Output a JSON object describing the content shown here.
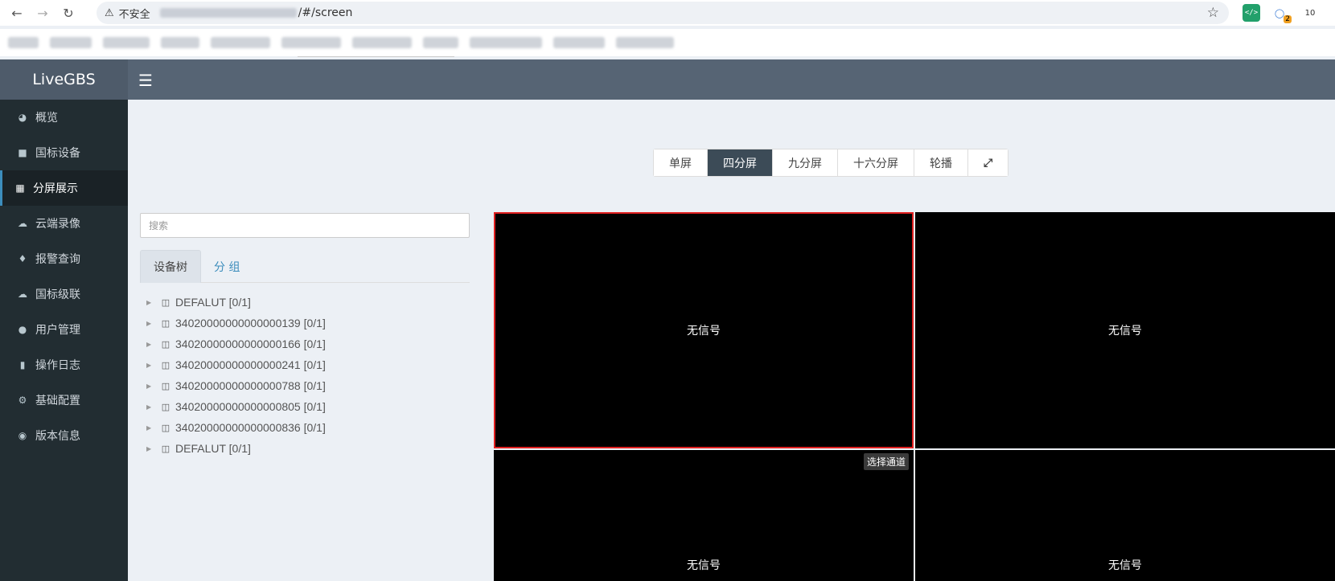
{
  "browser": {
    "insecure_label": "不安全",
    "url_path": "/#/screen",
    "back_icon": "arrow-left-icon",
    "forward_icon": "arrow-right-icon",
    "reload_icon": "reload-icon",
    "ext_badge_2": "2",
    "ext_badge_3": "10"
  },
  "app": {
    "logo": "LiveGBS"
  },
  "sidebar": {
    "items": [
      {
        "label": "概览",
        "icon": "dashboard-icon",
        "active": false
      },
      {
        "label": "国标设备",
        "icon": "video-camera-icon",
        "active": false
      },
      {
        "label": "分屏展示",
        "icon": "grid-icon",
        "active": true
      },
      {
        "label": "云端录像",
        "icon": "cloud-icon",
        "active": false
      },
      {
        "label": "报警查询",
        "icon": "bell-icon",
        "active": false
      },
      {
        "label": "国标级联",
        "icon": "cloud-upload-icon",
        "active": false
      },
      {
        "label": "用户管理",
        "icon": "users-icon",
        "active": false
      },
      {
        "label": "操作日志",
        "icon": "file-icon",
        "active": false
      },
      {
        "label": "基础配置",
        "icon": "cogs-icon",
        "active": false
      },
      {
        "label": "版本信息",
        "icon": "lifebuoy-icon",
        "active": false
      }
    ]
  },
  "layout_buttons": [
    {
      "label": "单屏",
      "active": false
    },
    {
      "label": "四分屏",
      "active": true
    },
    {
      "label": "九分屏",
      "active": false
    },
    {
      "label": "十六分屏",
      "active": false
    },
    {
      "label": "轮播",
      "active": false
    }
  ],
  "search": {
    "placeholder": "搜索"
  },
  "tabs": [
    {
      "label": "设备树",
      "active": true
    },
    {
      "label": "分 组",
      "active": false
    }
  ],
  "tree": [
    "DEFALUT [0/1]",
    "34020000000000000139 [0/1]",
    "34020000000000000166 [0/1]",
    "34020000000000000241 [0/1]",
    "34020000000000000788 [0/1]",
    "34020000000000000805 [0/1]",
    "34020000000000000836 [0/1]",
    "DEFALUT [0/1]"
  ],
  "players": {
    "no_signal": "无信号",
    "select_channel": "选择通道"
  },
  "colors": {
    "header": "#566474",
    "sidebar": "#222d32",
    "active_button": "#3c4b57",
    "selected_border": "#e02020"
  }
}
